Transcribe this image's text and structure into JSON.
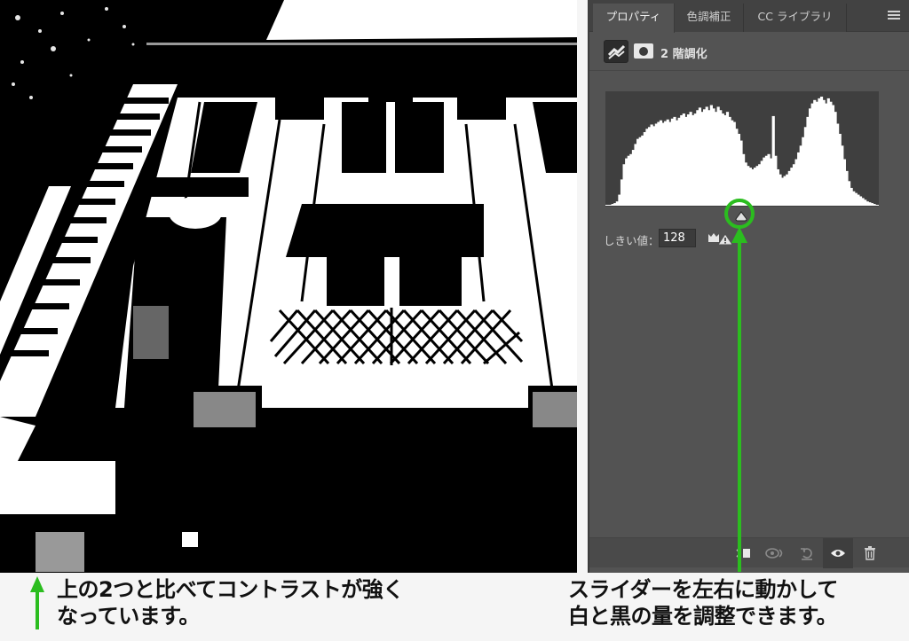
{
  "panel": {
    "tabs": [
      {
        "label": "プロパティ",
        "active": true
      },
      {
        "label": "色調補正",
        "active": false
      },
      {
        "label": "CC ライブラリ",
        "active": false
      }
    ],
    "menu_icon": "hamburger-menu-icon",
    "layer": {
      "adjustment_icon": "threshold-adjustment-icon",
      "mask_icon": "layer-mask-icon",
      "title": "2 階調化"
    },
    "histogram": {
      "type": "histogram",
      "bins": [
        0,
        1,
        2,
        4,
        12,
        30,
        48,
        55,
        58,
        60,
        65,
        72,
        78,
        80,
        82,
        86,
        90,
        92,
        95,
        93,
        96,
        98,
        100,
        97,
        99,
        101,
        98,
        102,
        104,
        100,
        103,
        106,
        108,
        104,
        107,
        110,
        106,
        108,
        112,
        115,
        110,
        113,
        116,
        112,
        118,
        114,
        110,
        116,
        112,
        108,
        106,
        110,
        104,
        100,
        98,
        90,
        84,
        76,
        60,
        50,
        46,
        44,
        42,
        44,
        46,
        48,
        52,
        56,
        58,
        60,
        55,
        105,
        58,
        42,
        36,
        32,
        34,
        36,
        40,
        44,
        48,
        54,
        62,
        70,
        80,
        92,
        104,
        114,
        120,
        124,
        122,
        126,
        128,
        124,
        120,
        126,
        122,
        118,
        110,
        96,
        84,
        70,
        54,
        40,
        28,
        20,
        16,
        14,
        12,
        10,
        8,
        6,
        4,
        3,
        2,
        1
      ],
      "threshold": 128,
      "range": [
        0,
        255
      ]
    },
    "threshold_label": "しきい値：",
    "threshold_value": "128",
    "warning_icons": [
      "clipping-warning-icon",
      "alert-triangle-icon"
    ],
    "footer_buttons": [
      {
        "icon": "clip-to-layer-icon",
        "active": false
      },
      {
        "icon": "view-previous-state-icon",
        "active": false
      },
      {
        "icon": "reset-icon",
        "active": false
      },
      {
        "icon": "visibility-eye-icon",
        "active": true
      },
      {
        "icon": "trash-icon",
        "active": false
      }
    ]
  },
  "annotations": {
    "accent_color": "#2bbd1f",
    "left_caption": [
      "上の2つと比べてコントラストが強く",
      "なっています。"
    ],
    "right_caption": [
      "スライダーを左右に動かして",
      "白と黒の量を調整できます。"
    ]
  },
  "photo": {
    "description": "threshold-image-building-facade"
  }
}
